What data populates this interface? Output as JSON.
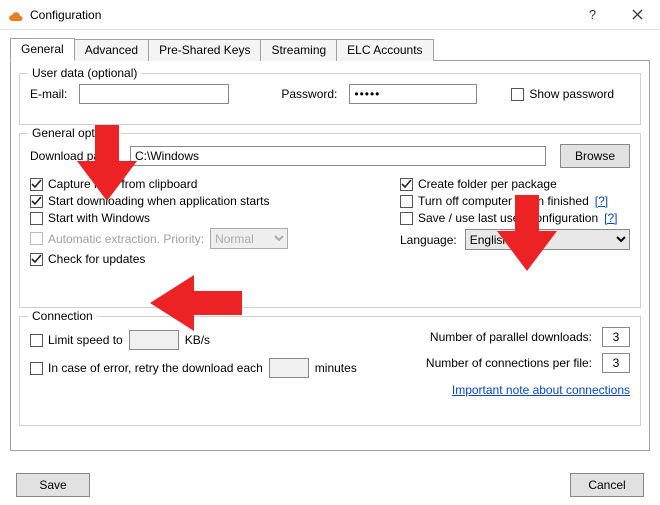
{
  "window": {
    "title": "Configuration"
  },
  "tabs": [
    "General",
    "Advanced",
    "Pre-Shared Keys",
    "Streaming",
    "ELC Accounts"
  ],
  "userdata": {
    "legend": "User data (optional)",
    "email_label": "E-mail:",
    "email_value": "",
    "password_label": "Password:",
    "password_value": "•••••",
    "showpass_label": "Show password"
  },
  "general": {
    "legend": "General options",
    "dlpath_label": "Download path:",
    "dlpath_value": "C:\\Windows",
    "browse": "Browse",
    "left_checks": [
      {
        "label": "Capture links from clipboard",
        "checked": true
      },
      {
        "label": "Start downloading when application starts",
        "checked": true
      },
      {
        "label": "Start with Windows",
        "checked": false
      },
      {
        "label": "Automatic extraction. Priority:",
        "checked": false,
        "disabled": true
      },
      {
        "label": "Check for updates",
        "checked": true
      }
    ],
    "priority_options": [
      "Normal"
    ],
    "priority_value": "Normal",
    "right_checks": [
      {
        "label": "Create folder per package",
        "checked": true,
        "help": false
      },
      {
        "label": "Turn off computer when finished",
        "checked": false,
        "help": true
      },
      {
        "label": "Save / use last used configuration",
        "checked": false,
        "help": true
      }
    ],
    "language_label": "Language:",
    "language_value": "English",
    "language_options": [
      "English"
    ],
    "helpq": "[?]"
  },
  "connection": {
    "legend": "Connection",
    "limit_label": "Limit speed to",
    "limit_value": "",
    "limit_unit": "KB/s",
    "retry_label": "In case of error, retry the download each",
    "retry_value": "",
    "retry_unit": "minutes",
    "parallel_label": "Number of parallel downloads:",
    "parallel_value": "3",
    "perfile_label": "Number of connections per file:",
    "perfile_value": "3",
    "note_link": "Important note about connections"
  },
  "buttons": {
    "save": "Save",
    "cancel": "Cancel"
  }
}
